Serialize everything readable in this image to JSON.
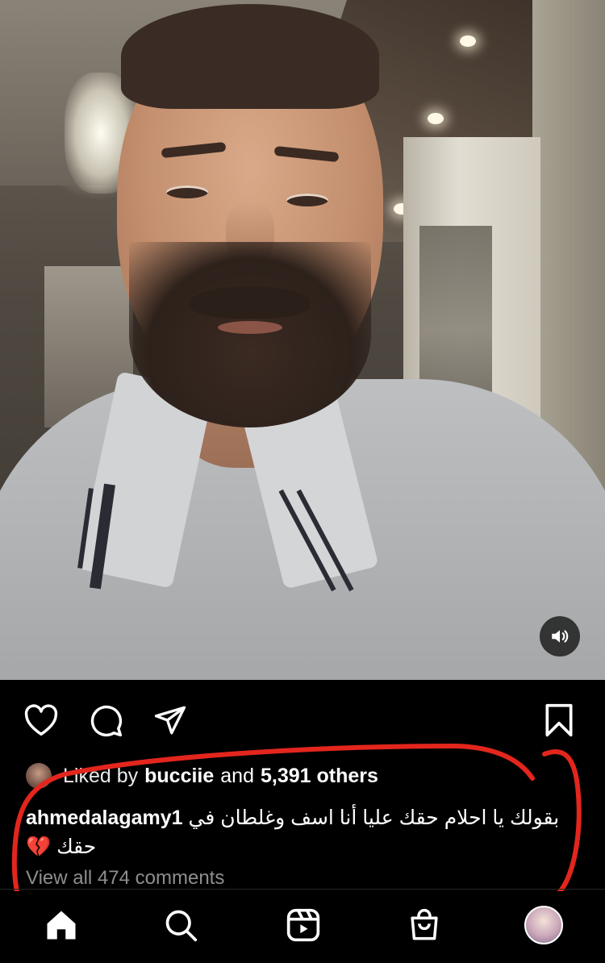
{
  "post": {
    "likes": {
      "prefix": "Liked by",
      "user": "bucciie",
      "joiner": "and",
      "others": "5,391 others"
    },
    "caption": {
      "username": "ahmedalagamy1",
      "text": "بقولك يا احلام حقك عليا أنا اسف وغلطان في حقك 💔"
    },
    "view_comments": "View all 474 comments"
  },
  "icons": {
    "like": "heart-icon",
    "comment": "comment-icon",
    "share": "paper-plane-icon",
    "save": "bookmark-icon",
    "mute": "speaker-icon",
    "home": "home-icon",
    "search": "search-icon",
    "reels": "reels-icon",
    "shop": "shopping-bag-icon",
    "profile": "profile-avatar"
  },
  "colors": {
    "background": "#000000",
    "secondary_text": "#8e8e8e",
    "annotation": "#e3261d"
  }
}
